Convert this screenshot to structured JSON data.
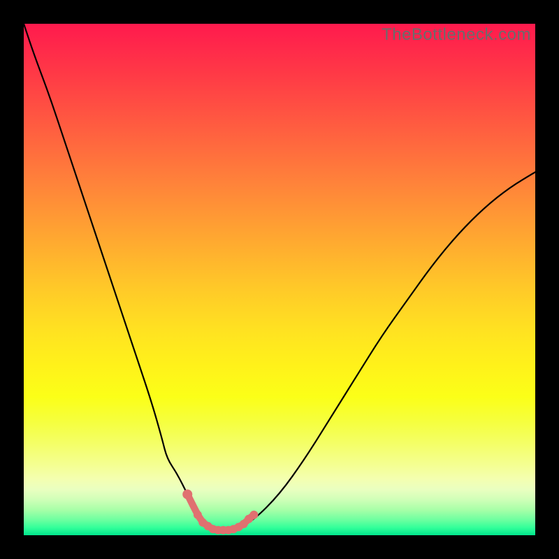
{
  "watermark": {
    "text": "TheBottleneck.com"
  },
  "colors": {
    "curve_stroke": "#000000",
    "highlight_stroke": "#e07070",
    "highlight_fill": "#e07070",
    "frame": "#000000"
  },
  "chart_data": {
    "type": "line",
    "title": "",
    "xlabel": "",
    "ylabel": "",
    "xlim": [
      0,
      100
    ],
    "ylim": [
      0,
      100
    ],
    "grid": false,
    "series": [
      {
        "name": "bottleneck-curve",
        "x": [
          0,
          2,
          5,
          8,
          10,
          12,
          15,
          18,
          20,
          22,
          25,
          27,
          28,
          30,
          32,
          34,
          36,
          38,
          40,
          42,
          45,
          50,
          55,
          60,
          65,
          70,
          75,
          80,
          85,
          90,
          95,
          100
        ],
        "y": [
          100,
          94,
          86,
          77,
          71,
          65,
          56,
          47,
          41,
          35,
          26,
          19,
          15,
          12,
          8,
          4,
          2,
          1,
          1,
          1.5,
          3,
          8,
          15,
          23,
          31,
          39,
          46,
          53,
          59,
          64,
          68,
          71
        ]
      }
    ],
    "highlight": {
      "name": "optimal-range",
      "points": [
        {
          "x": 32,
          "y": 8
        },
        {
          "x": 34,
          "y": 4
        },
        {
          "x": 35,
          "y": 2.5
        },
        {
          "x": 36,
          "y": 1.8
        },
        {
          "x": 37,
          "y": 1.2
        },
        {
          "x": 38,
          "y": 1
        },
        {
          "x": 39,
          "y": 1
        },
        {
          "x": 40,
          "y": 1
        },
        {
          "x": 41,
          "y": 1.2
        },
        {
          "x": 42,
          "y": 1.6
        },
        {
          "x": 43,
          "y": 2.2
        },
        {
          "x": 44,
          "y": 3.2
        },
        {
          "x": 45,
          "y": 4
        }
      ]
    }
  }
}
